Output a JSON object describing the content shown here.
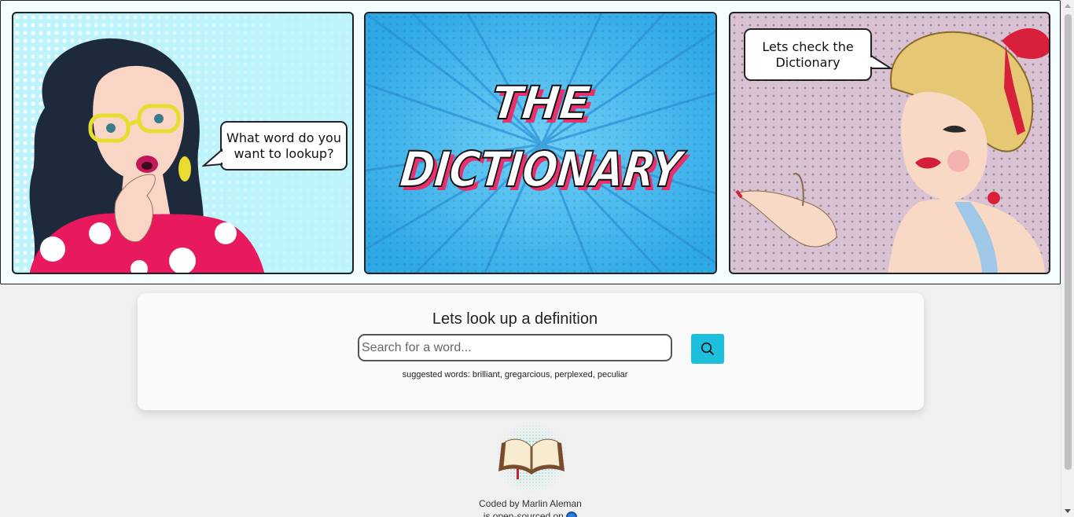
{
  "header": {
    "left_bubble": "What word do you want to lookup?",
    "center_title_line1": "THE",
    "center_title_line2": "DICTIONARY",
    "right_bubble": "Lets check the Dictionary"
  },
  "search": {
    "heading": "Lets look up a definition",
    "placeholder": "Search for a word...",
    "value": "",
    "button_icon": "search-icon",
    "suggested": "suggested words: brilliant, gregarcious, perplexed, peculiar"
  },
  "footer": {
    "credit": "Coded by Marlin Aleman",
    "credit_line2": "is open-sourced on",
    "logo_icon": "open-book-icon",
    "source_icon": "github-icon"
  },
  "colors": {
    "accent": "#1cc0dd",
    "left_panel": "#bdf4fb",
    "center_panel": "#48bdf0",
    "right_panel": "#d9c2d3",
    "title_shadow": "#e8316c"
  }
}
